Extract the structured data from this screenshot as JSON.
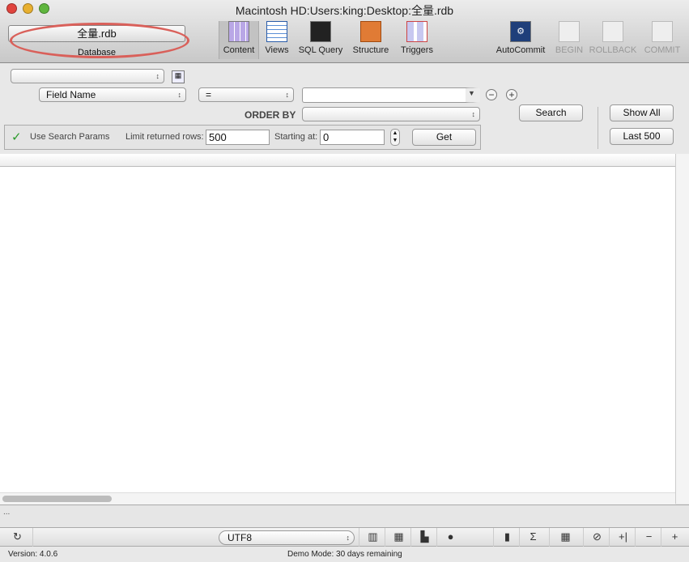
{
  "window": {
    "title": "Macintosh HD:Users:king:Desktop:全量.rdb"
  },
  "toolbar": {
    "database_button": "全量.rdb",
    "database_label": "Database",
    "items": [
      {
        "label": "Content",
        "icon": "content-grid-icon",
        "selected": true
      },
      {
        "label": "Views",
        "icon": "views-grid-icon"
      },
      {
        "label": "SQL Query",
        "icon": "terminal-icon"
      },
      {
        "label": "Structure",
        "icon": "structure-icon"
      },
      {
        "label": "Triggers",
        "icon": "triggers-icon"
      }
    ],
    "right": [
      {
        "label": "AutoCommit",
        "icon": "gear-icon",
        "enabled": true
      },
      {
        "label": "BEGIN",
        "enabled": false
      },
      {
        "label": "ROLLBACK",
        "enabled": false
      },
      {
        "label": "COMMIT",
        "enabled": false
      }
    ]
  },
  "filter": {
    "table_select": "",
    "field_select": "Field Name",
    "operator_select": "=",
    "value": "",
    "order_by_label": "ORDER BY",
    "order_by_select": "",
    "search": "Search",
    "show_all": "Show All",
    "last_500": "Last 500",
    "use_search_params": "Use Search Params",
    "limit_label": "Limit returned rows:",
    "limit_value": "500",
    "start_label": "Starting at:",
    "start_value": "0",
    "get": "Get"
  },
  "status": {
    "line": "...",
    "encoding": "UTF8",
    "version": "Version: 4.0.6",
    "demo": "Demo Mode: 30 days remaining"
  },
  "colors": {
    "highlight_ellipse": "#d9605a",
    "autocommit_icon": "#1f3f7a"
  }
}
